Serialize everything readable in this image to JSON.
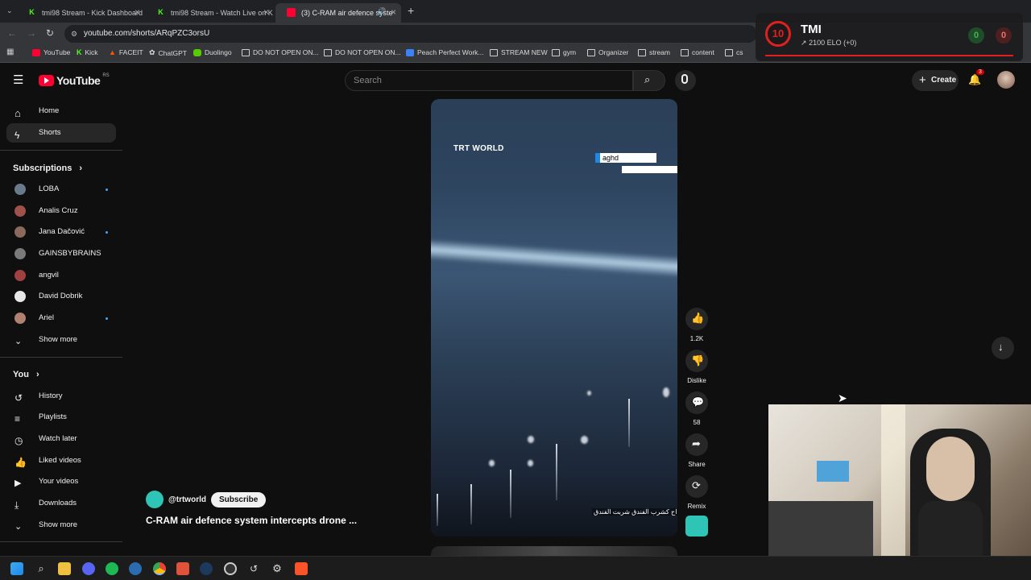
{
  "browser": {
    "tabs": [
      {
        "title": "tmi98 Stream - Kick Dashboard",
        "favicon": "kick-icon"
      },
      {
        "title": "tmi98 Stream - Watch Live on K",
        "favicon": "kick-icon"
      },
      {
        "title": "(3) C-RAM air defence syste",
        "favicon": "youtube-icon"
      }
    ],
    "url": "youtube.com/shorts/ARqPZC3orsU",
    "bookmarks": [
      "YouTube",
      "Kick",
      "FACEIT",
      "ChatGPT",
      "Duolingo",
      "DO NOT OPEN ON...",
      "DO NOT OPEN ON...",
      "Peach Perfect Work...",
      "STREAM NEW",
      "gym",
      "Organizer",
      "stream",
      "content",
      "cs"
    ]
  },
  "youtube": {
    "logo_text": "YouTube",
    "region": "RS",
    "search_placeholder": "Search",
    "create_label": "Create",
    "notifications_count": "3",
    "sidebar": {
      "top": [
        {
          "label": "Home",
          "icon": "home-icon"
        },
        {
          "label": "Shorts",
          "icon": "shorts-icon"
        }
      ],
      "subscriptions_title": "Subscriptions",
      "subscriptions": [
        {
          "label": "LOBA",
          "new": true
        },
        {
          "label": "Analis Cruz",
          "new": false
        },
        {
          "label": "Jana Dačović",
          "new": true
        },
        {
          "label": "GAINSBYBRAINS",
          "new": false
        },
        {
          "label": "angvil",
          "new": false
        },
        {
          "label": "David Dobrik",
          "new": false
        },
        {
          "label": "Ariel",
          "new": true
        }
      ],
      "show_more": "Show more",
      "you_title": "You",
      "you_items": [
        {
          "label": "History",
          "icon": "history-icon"
        },
        {
          "label": "Playlists",
          "icon": "playlists-icon"
        },
        {
          "label": "Watch later",
          "icon": "watch-later-icon"
        },
        {
          "label": "Liked videos",
          "icon": "liked-videos-icon"
        },
        {
          "label": "Your videos",
          "icon": "your-videos-icon"
        },
        {
          "label": "Downloads",
          "icon": "downloads-icon"
        }
      ],
      "show_more_2": "Show more"
    },
    "short": {
      "watermark": "TRT WORLD",
      "location_tag": "aghd",
      "caption_overlay": "اح كشرب الفندق شربت الفندق",
      "channel": "@trtworld",
      "subscribe": "Subscribe",
      "title": "C-RAM air defence system intercepts drone ...",
      "likes": "1.2K",
      "dislike": "Dislike",
      "comments": "58",
      "share": "Share",
      "remix": "Remix"
    }
  },
  "overlay": {
    "faceit_level": "10",
    "player_name": "TMI",
    "elo": "2100 ELO (+0)",
    "score_left": "0",
    "score_right": "0"
  }
}
